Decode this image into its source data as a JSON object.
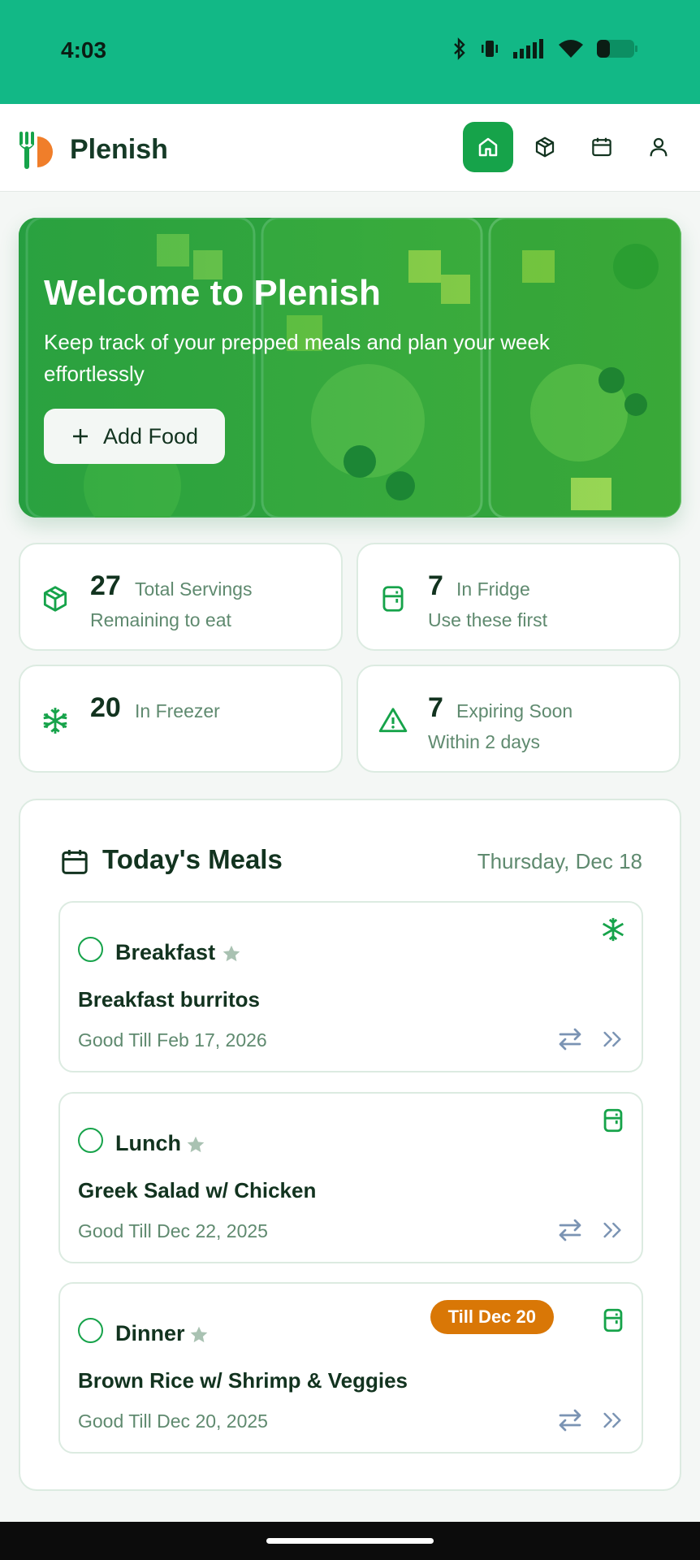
{
  "status_bar": {
    "time": "4:03",
    "icons": [
      "bluetooth-icon",
      "vibrate-icon",
      "signal-icon",
      "wifi-icon",
      "battery-icon"
    ]
  },
  "header": {
    "app_name": "Plenish",
    "nav": [
      {
        "name": "home",
        "icon": "home-icon",
        "active": true
      },
      {
        "name": "inventory",
        "icon": "box-icon",
        "active": false
      },
      {
        "name": "calendar",
        "icon": "calendar-icon",
        "active": false
      },
      {
        "name": "profile",
        "icon": "user-icon",
        "active": false
      }
    ]
  },
  "hero": {
    "title": "Welcome to Plenish",
    "subtitle": "Keep track of your prepped meals and plan your week effortlessly",
    "add_button_label": "Add Food"
  },
  "stats": [
    {
      "value": "27",
      "label": "Total Servings",
      "sub": "Remaining to eat",
      "icon": "box-icon"
    },
    {
      "value": "7",
      "label": "In Fridge",
      "sub": "Use these first",
      "icon": "fridge-icon"
    },
    {
      "value": "20",
      "label": "In Freezer",
      "sub": "",
      "icon": "snowflake-icon"
    },
    {
      "value": "7",
      "label": "Expiring Soon",
      "sub": "Within 2 days",
      "icon": "warning-icon"
    }
  ],
  "todays_meals": {
    "title": "Today's Meals",
    "date": "Thursday, Dec 18",
    "meals": [
      {
        "type": "Breakfast",
        "name": "Breakfast burritos",
        "good_till": "Good Till Feb 17, 2026",
        "location_icon": "snowflake-icon",
        "badge": ""
      },
      {
        "type": "Lunch",
        "name": "Greek Salad w/ Chicken",
        "good_till": "Good Till Dec 22, 2025",
        "location_icon": "fridge-icon",
        "badge": ""
      },
      {
        "type": "Dinner",
        "name": "Brown Rice w/ Shrimp & Veggies",
        "good_till": "Good Till Dec 20, 2025",
        "location_icon": "fridge-icon",
        "badge": "Till Dec 20"
      }
    ]
  },
  "colors": {
    "status_bar": "#12b886",
    "primary_green": "#16a34a",
    "text_dark": "#12331f",
    "text_muted": "#5f8a6f",
    "badge_orange": "#d97706",
    "action_blue_gray": "#7a93b3"
  }
}
